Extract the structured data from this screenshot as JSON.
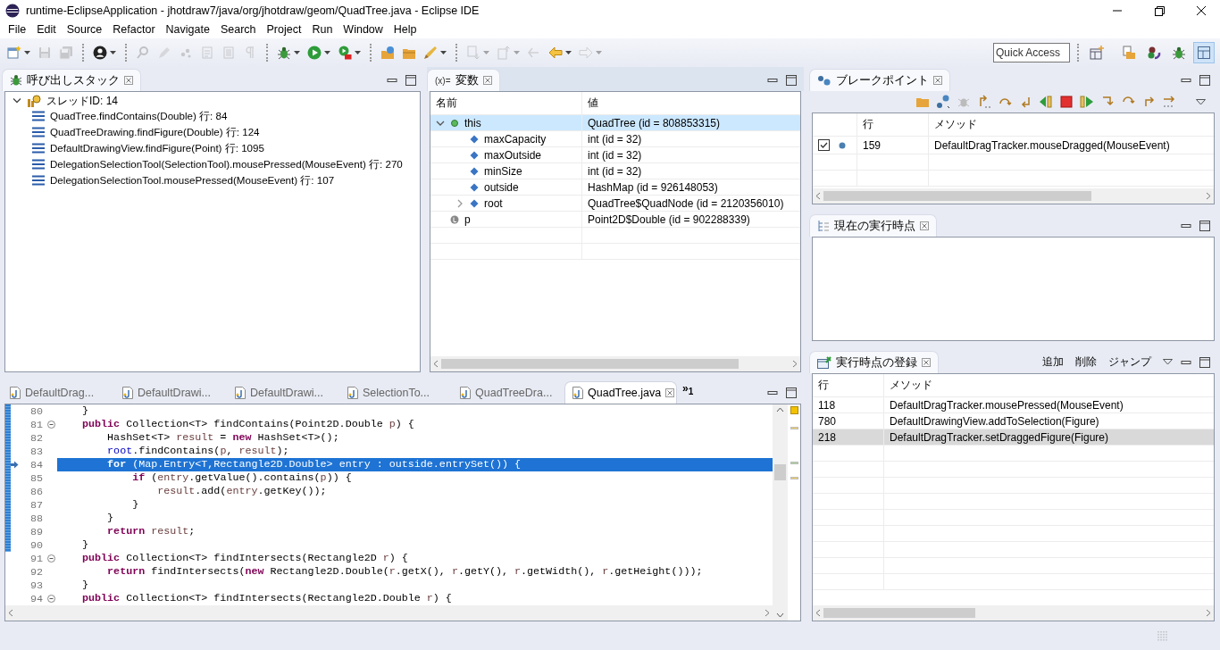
{
  "window": {
    "title": "runtime-EclipseApplication - jhotdraw7/java/org/jhotdraw/geom/QuadTree.java - Eclipse IDE"
  },
  "menu": [
    {
      "label": "File"
    },
    {
      "label": "Edit"
    },
    {
      "label": "Source"
    },
    {
      "label": "Refactor"
    },
    {
      "label": "Navigate"
    },
    {
      "label": "Search"
    },
    {
      "label": "Project"
    },
    {
      "label": "Run"
    },
    {
      "label": "Window"
    },
    {
      "label": "Help"
    }
  ],
  "toolbar": {
    "items": [
      {
        "kind": "new",
        "disabled": false,
        "dropdown": true
      },
      {
        "kind": "save",
        "disabled": true,
        "dropdown": false
      },
      {
        "kind": "save-all",
        "disabled": true,
        "dropdown": false
      },
      {
        "kind": "separator"
      },
      {
        "kind": "person",
        "disabled": false,
        "dropdown": true
      },
      {
        "kind": "separator"
      },
      {
        "kind": "pin",
        "disabled": true,
        "dropdown": false
      },
      {
        "kind": "pen",
        "disabled": true,
        "dropdown": false
      },
      {
        "kind": "footprint",
        "disabled": true,
        "dropdown": false
      },
      {
        "kind": "document",
        "disabled": true,
        "dropdown": false
      },
      {
        "kind": "list",
        "disabled": true,
        "dropdown": false
      },
      {
        "kind": "pilcrow",
        "disabled": true,
        "dropdown": false
      },
      {
        "kind": "separator"
      },
      {
        "kind": "bug",
        "disabled": false,
        "dropdown": true
      },
      {
        "kind": "run",
        "disabled": false,
        "dropdown": true
      },
      {
        "kind": "run-tool",
        "disabled": false,
        "dropdown": true
      },
      {
        "kind": "separator"
      },
      {
        "kind": "folder-globe",
        "disabled": false,
        "dropdown": false
      },
      {
        "kind": "folder",
        "disabled": false,
        "dropdown": false
      },
      {
        "kind": "brush",
        "disabled": false,
        "dropdown": true
      },
      {
        "kind": "separator"
      },
      {
        "kind": "next-annotation",
        "disabled": true,
        "dropdown": true
      },
      {
        "kind": "prev-annotation",
        "disabled": true,
        "dropdown": true
      },
      {
        "kind": "last-edit",
        "disabled": true,
        "dropdown": false
      },
      {
        "kind": "back",
        "disabled": false,
        "dropdown": true
      },
      {
        "kind": "forward",
        "disabled": true,
        "dropdown": true
      }
    ],
    "quick_access": {
      "placeholder": "Quick Access"
    },
    "perspectives": [
      {
        "kind": "open-perspective",
        "selected": false
      },
      {
        "kind": "resource",
        "selected": false
      },
      {
        "kind": "team",
        "selected": false
      },
      {
        "kind": "debug",
        "selected": false
      },
      {
        "kind": "layout",
        "selected": true
      }
    ]
  },
  "call_stack": {
    "title": "呼び出しスタック",
    "thread": {
      "label": "スレッドID: 14",
      "expanded": true,
      "frames": [
        "QuadTree.findContains(Double) 行: 84",
        "QuadTreeDrawing.findFigure(Double) 行: 124",
        "DefaultDrawingView.findFigure(Point) 行: 1095",
        "DelegationSelectionTool(SelectionTool).mousePressed(MouseEvent) 行: 270",
        "DelegationSelectionTool.mousePressed(MouseEvent) 行: 107"
      ]
    }
  },
  "variables": {
    "icon_text": "(x)=",
    "title": "変数",
    "columns": [
      "名前",
      "値"
    ],
    "rows": [
      {
        "name": "this",
        "value": "QuadTree (id = 808853315)",
        "kind": "object",
        "expanded": true,
        "selected": true,
        "children": [
          {
            "name": "maxCapacity",
            "value": "int (id = 32)",
            "kind": "field",
            "selected": false
          },
          {
            "name": "maxOutside",
            "value": "int (id = 32)",
            "kind": "field",
            "selected": false
          },
          {
            "name": "minSize",
            "value": "int (id = 32)",
            "kind": "field",
            "selected": false
          },
          {
            "name": "outside",
            "value": "HashMap (id = 926148053)",
            "kind": "field",
            "selected": false
          },
          {
            "name": "root",
            "value": "QuadTree$QuadNode (id = 2120356010)",
            "kind": "field",
            "expanded": false,
            "selected": false
          }
        ]
      },
      {
        "name": "p",
        "value": "Point2D$Double (id = 902288339)",
        "kind": "local",
        "selected": false
      }
    ]
  },
  "breakpoints": {
    "title": "ブレークポイント",
    "columns": [
      "行",
      "メソッド"
    ],
    "rows": [
      {
        "checked": true,
        "line": "159",
        "method": "DefaultDragTracker.mouseDragged(MouseEvent)"
      }
    ]
  },
  "current_point": {
    "title": "現在の実行時点"
  },
  "registered_points": {
    "title": "実行時点の登録",
    "actions": [
      "追加",
      "削除",
      "ジャンプ"
    ],
    "columns": [
      "行",
      "メソッド"
    ],
    "rows": [
      {
        "line": "118",
        "method": "DefaultDragTracker.mousePressed(MouseEvent)",
        "selected": false
      },
      {
        "line": "780",
        "method": "DefaultDrawingView.addToSelection(Figure)",
        "selected": false
      },
      {
        "line": "218",
        "method": "DefaultDragTracker.setDraggedFigure(Figure)",
        "selected": true
      }
    ]
  },
  "editor": {
    "tabs": [
      {
        "label": "DefaultDrag...",
        "selected": false
      },
      {
        "label": "DefaultDrawi...",
        "selected": false
      },
      {
        "label": "DefaultDrawi...",
        "selected": false
      },
      {
        "label": "SelectionTo...",
        "selected": false
      },
      {
        "label": "QuadTreeDra...",
        "selected": false
      },
      {
        "label": "QuadTree.java",
        "selected": true
      }
    ],
    "overflow": "»$_{1}$",
    "lines": [
      {
        "number": "80",
        "foldable": false,
        "in_range": true,
        "current": false,
        "tokens": [
          {
            "kind": "plain",
            "text": "    }"
          }
        ]
      },
      {
        "number": "81",
        "foldable": true,
        "in_range": true,
        "current": false,
        "tokens": [
          {
            "kind": "keyword",
            "text": "    public"
          },
          {
            "kind": "plain",
            "text": " Collection<T> findContains(Point2D.Double "
          },
          {
            "kind": "variable",
            "text": "p"
          },
          {
            "kind": "plain",
            "text": ") {"
          }
        ]
      },
      {
        "number": "82",
        "foldable": false,
        "in_range": true,
        "current": false,
        "tokens": [
          {
            "kind": "plain",
            "text": "        HashSet<T> "
          },
          {
            "kind": "variable",
            "text": "result"
          },
          {
            "kind": "plain",
            "text": " = "
          },
          {
            "kind": "keyword",
            "text": "new"
          },
          {
            "kind": "plain",
            "text": " HashSet<T>();"
          }
        ]
      },
      {
        "number": "83",
        "foldable": false,
        "in_range": true,
        "current": false,
        "tokens": [
          {
            "kind": "field",
            "text": "        root"
          },
          {
            "kind": "plain",
            "text": ".findContains("
          },
          {
            "kind": "variable",
            "text": "p"
          },
          {
            "kind": "plain",
            "text": ", "
          },
          {
            "kind": "variable",
            "text": "result"
          },
          {
            "kind": "plain",
            "text": ");"
          }
        ]
      },
      {
        "number": "84",
        "foldable": false,
        "in_range": true,
        "current": true,
        "tokens": [
          {
            "kind": "keyword",
            "text": "        for"
          },
          {
            "kind": "plain",
            "text": " (Map.Entry<T,Rectangle2D.Double> "
          },
          {
            "kind": "variable",
            "text": "entry"
          },
          {
            "kind": "plain",
            "text": " : "
          },
          {
            "kind": "field",
            "text": "outside"
          },
          {
            "kind": "plain",
            "text": ".entrySet()) {"
          }
        ]
      },
      {
        "number": "85",
        "foldable": false,
        "in_range": true,
        "current": false,
        "tokens": [
          {
            "kind": "keyword",
            "text": "            if"
          },
          {
            "kind": "plain",
            "text": " ("
          },
          {
            "kind": "variable",
            "text": "entry"
          },
          {
            "kind": "plain",
            "text": ".getValue().contains("
          },
          {
            "kind": "variable",
            "text": "p"
          },
          {
            "kind": "plain",
            "text": ")) {"
          }
        ]
      },
      {
        "number": "86",
        "foldable": false,
        "in_range": true,
        "current": false,
        "tokens": [
          {
            "kind": "variable",
            "text": "                result"
          },
          {
            "kind": "plain",
            "text": ".add("
          },
          {
            "kind": "variable",
            "text": "entry"
          },
          {
            "kind": "plain",
            "text": ".getKey());"
          }
        ]
      },
      {
        "number": "87",
        "foldable": false,
        "in_range": true,
        "current": false,
        "tokens": [
          {
            "kind": "plain",
            "text": "            }"
          }
        ]
      },
      {
        "number": "88",
        "foldable": false,
        "in_range": true,
        "current": false,
        "tokens": [
          {
            "kind": "plain",
            "text": "        }"
          }
        ]
      },
      {
        "number": "89",
        "foldable": false,
        "in_range": true,
        "current": false,
        "tokens": [
          {
            "kind": "keyword",
            "text": "        return"
          },
          {
            "kind": "variable",
            "text": " result"
          },
          {
            "kind": "plain",
            "text": ";"
          }
        ]
      },
      {
        "number": "90",
        "foldable": false,
        "in_range": true,
        "current": false,
        "tokens": [
          {
            "kind": "plain",
            "text": "    }"
          }
        ]
      },
      {
        "number": "91",
        "foldable": true,
        "in_range": false,
        "current": false,
        "tokens": [
          {
            "kind": "keyword",
            "text": "    public"
          },
          {
            "kind": "plain",
            "text": " Collection<T> findIntersects(Rectangle2D "
          },
          {
            "kind": "variable",
            "text": "r"
          },
          {
            "kind": "plain",
            "text": ") {"
          }
        ]
      },
      {
        "number": "92",
        "foldable": false,
        "in_range": false,
        "current": false,
        "tokens": [
          {
            "kind": "keyword",
            "text": "        return"
          },
          {
            "kind": "plain",
            "text": " findIntersects("
          },
          {
            "kind": "keyword",
            "text": "new"
          },
          {
            "kind": "plain",
            "text": " Rectangle2D.Double("
          },
          {
            "kind": "variable",
            "text": "r"
          },
          {
            "kind": "plain",
            "text": ".getX(), "
          },
          {
            "kind": "variable",
            "text": "r"
          },
          {
            "kind": "plain",
            "text": ".getY(), "
          },
          {
            "kind": "variable",
            "text": "r"
          },
          {
            "kind": "plain",
            "text": ".getWidth(), "
          },
          {
            "kind": "variable",
            "text": "r"
          },
          {
            "kind": "plain",
            "text": ".getHeight()));"
          }
        ]
      },
      {
        "number": "93",
        "foldable": false,
        "in_range": false,
        "current": false,
        "tokens": [
          {
            "kind": "plain",
            "text": "    }"
          }
        ]
      },
      {
        "number": "94",
        "foldable": true,
        "in_range": false,
        "current": false,
        "tokens": [
          {
            "kind": "keyword",
            "text": "    public"
          },
          {
            "kind": "plain",
            "text": " Collection<T> findIntersects(Rectangle2D.Double "
          },
          {
            "kind": "variable",
            "text": "r"
          },
          {
            "kind": "plain",
            "text": ") {"
          }
        ]
      }
    ]
  }
}
